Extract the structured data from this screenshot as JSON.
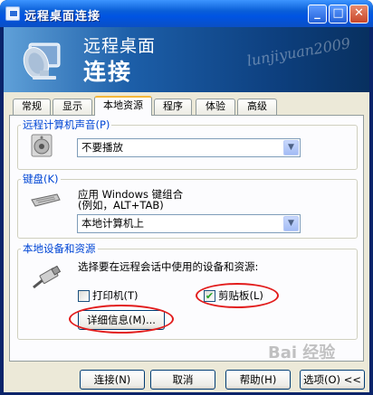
{
  "window": {
    "title": "远程桌面连接",
    "controls": {
      "minimize": "_",
      "maximize": "□",
      "close": "✕"
    }
  },
  "banner": {
    "line1": "远程桌面",
    "line2": "连接",
    "watermark": "lunjiyuan2009"
  },
  "tabs": [
    {
      "label": "常规",
      "active": false
    },
    {
      "label": "显示",
      "active": false
    },
    {
      "label": "本地资源",
      "active": true
    },
    {
      "label": "程序",
      "active": false
    },
    {
      "label": "体验",
      "active": false
    },
    {
      "label": "高级",
      "active": false
    }
  ],
  "sound_group": {
    "title": "远程计算机声音(P)",
    "combo_value": "不要播放",
    "icon": "speaker-icon"
  },
  "keyboard_group": {
    "title": "键盘(K)",
    "desc_line1": "应用 Windows 键组合",
    "desc_line2": "(例如，ALT+TAB)",
    "combo_value": "本地计算机上",
    "icon": "keyboard-icon"
  },
  "devices_group": {
    "title": "本地设备和资源",
    "desc": "选择要在远程会话中使用的设备和资源:",
    "printer_label": "打印机(T)",
    "printer_checked": false,
    "clipboard_label": "剪贴板(L)",
    "clipboard_checked": true,
    "details_label": "详细信息(M)...",
    "icon": "usb-plug-icon"
  },
  "buttons": {
    "connect": "连接(N)",
    "cancel": "取消",
    "help": "帮助(H)",
    "options": "选项(O) <<"
  },
  "watermark_bottom": "Bai 经验",
  "colors": {
    "titlebar": "#0054e3",
    "group_title": "#0046d5",
    "annotation": "#e21c1c",
    "check": "#21a121"
  }
}
